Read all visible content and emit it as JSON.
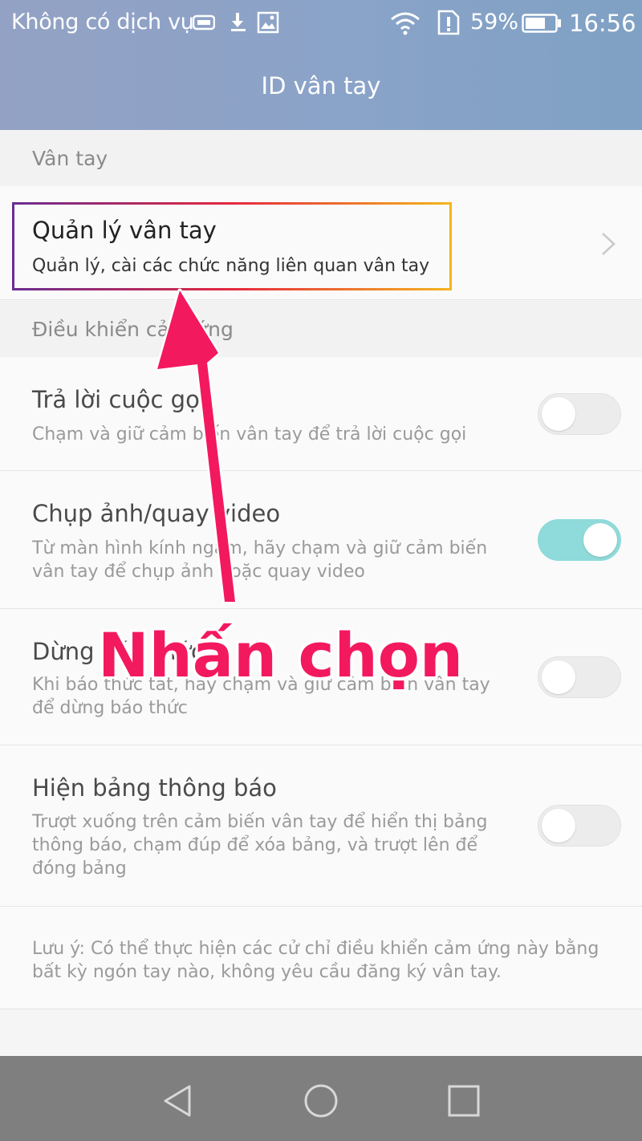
{
  "status_bar": {
    "carrier": "Không có dịch vụ",
    "battery": "59%",
    "time": "16:56",
    "icons": [
      "sim-icon",
      "download-icon",
      "image-icon",
      "wifi-icon",
      "sim-alert-icon",
      "battery-icon"
    ]
  },
  "app_bar": {
    "title": "ID vân tay"
  },
  "sections": {
    "fingerprint_header": "Vân tay",
    "touch_header": "Điều khiển cảm ứng"
  },
  "manage": {
    "title": "Quản lý vân tay",
    "subtitle": "Quản lý, cài các chức năng liên quan vân tay"
  },
  "settings": [
    {
      "title": "Trả lời cuộc gọi",
      "subtitle": "Chạm và giữ cảm biến vân tay để trả lời cuộc gọi",
      "enabled": false
    },
    {
      "title": "Chụp ảnh/quay video",
      "subtitle": "Từ màn hình kính ngắm, hãy chạm và giữ cảm biến vân tay để chụp ảnh hoặc quay video",
      "enabled": true
    },
    {
      "title": "Dừng báo thức",
      "subtitle": "Khi báo thức tắt, hãy chạm và giữ cảm biến vân tay để dừng báo thức",
      "enabled": false
    },
    {
      "title": "Hiện bảng thông báo",
      "subtitle": "Trượt xuống trên cảm biến vân tay để hiển thị bảng thông báo, chạm đúp để xóa bảng, và trượt lên để đóng bảng",
      "enabled": false
    }
  ],
  "note": "Lưu ý: Có thể thực hiện các cử chỉ điều khiển cảm ứng này bằng bất kỳ ngón tay nào, không yêu cầu đăng ký vân tay.",
  "annotation": {
    "label": "Nhấn chọn",
    "color": "#f3195f"
  },
  "colors": {
    "toggle_on": "#8fdada",
    "app_bar": "#8aa3c8"
  }
}
